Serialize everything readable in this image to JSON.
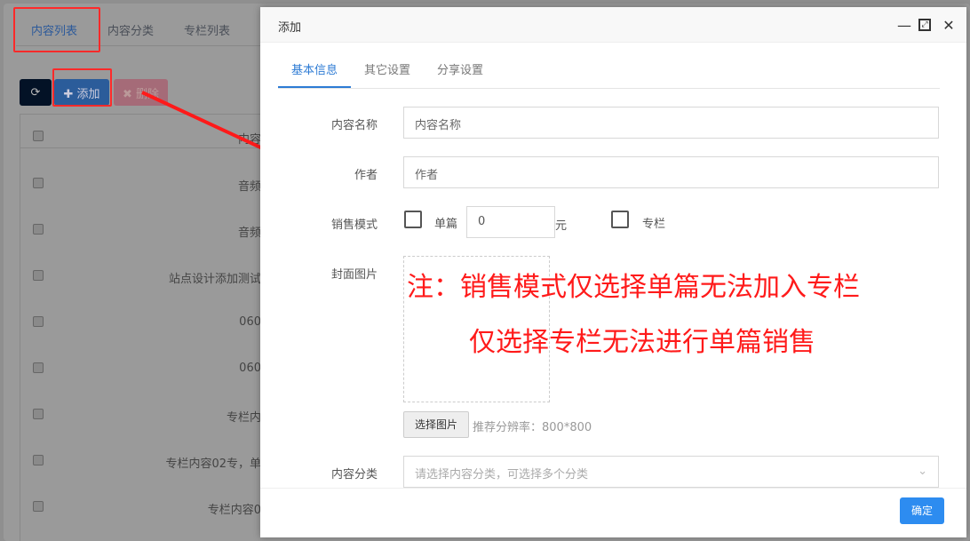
{
  "tabs": [
    "内容列表",
    "内容分类",
    "专栏列表"
  ],
  "toolbar": {
    "add": "✚ 添加",
    "delete": "✖ 删除"
  },
  "table": {
    "header": "内容",
    "rows": [
      "音频",
      "音频",
      "站点设计添加测试",
      "060",
      "060",
      "专栏内",
      "专栏内容02专，单",
      "专栏内容0"
    ]
  },
  "modal": {
    "title": "添加",
    "tabs": [
      "基本信息",
      "其它设置",
      "分享设置"
    ],
    "fields": {
      "name_label": "内容名称",
      "name_placeholder": "内容名称",
      "author_label": "作者",
      "author_placeholder": "作者",
      "sale_label": "销售模式",
      "single": "单篇",
      "price": "0",
      "unit": "元",
      "column": "专栏",
      "cover_label": "封面图片",
      "choose": "选择图片",
      "hint": "推荐分辨率：800*800",
      "category_label": "内容分类",
      "category_placeholder": "请选择内容分类，可选择多个分类"
    },
    "confirm": "确定"
  },
  "annotation": {
    "line1": "注：销售模式仅选择单篇无法加入专栏",
    "line2": "仅选择专栏无法进行单篇销售"
  },
  "colors": {
    "accent": "#2d7bd4",
    "annotation": "#ff1a1a"
  }
}
